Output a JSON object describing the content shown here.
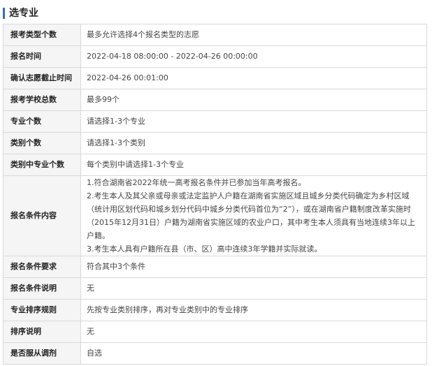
{
  "section": {
    "title": "选专业"
  },
  "rows": [
    {
      "label": "报考类型个数",
      "value": "最多允许选择4个报名类型的志愿"
    },
    {
      "label": "报名时间",
      "value": "2022-04-18 08:00:00 - 2022-04-26 00:00:00"
    },
    {
      "label": "确认志愿截止时间",
      "value": "2022-04-26 00:01:00"
    },
    {
      "label": "报考学校总数",
      "value": "最多99个"
    },
    {
      "label": "专业个数",
      "value": "请选择1-3个专业"
    },
    {
      "label": "类别个数",
      "value": "请选择1-3个类别"
    },
    {
      "label": "类别中专业个数",
      "value": "每个类别中请选择1-3个专业"
    },
    {
      "label": "报名条件内容",
      "lines": [
        "1.符合湖南省2022年统一高考报名条件并已参加当年高考报名。",
        "2.考生本人及其父亲或母亲或法定监护人户籍在湖南省实施区域且城乡分类代码确定为乡村区域（统计用区划代码和城乡划分代码中城乡分类代码首位为“2”），或在湖南省户籍制度改革实施时（2015年12月31日）户籍为湖南省实施区域的农业户口，其中考生本人须具有当地连续3年以上户籍。",
        "3.考生本人具有户籍所在县（市、区）高中连续3年学籍并实际就读。"
      ]
    },
    {
      "label": "报名条件要求",
      "value": "符合其中3个条件"
    },
    {
      "label": "报名条件说明",
      "value": "无"
    },
    {
      "label": "专业排序规则",
      "value": "先按专业类别排序，再对专业类别中的专业排序"
    },
    {
      "label": "排序说明",
      "value": "无"
    },
    {
      "label": "是否服从调剂",
      "value": "自选"
    }
  ]
}
